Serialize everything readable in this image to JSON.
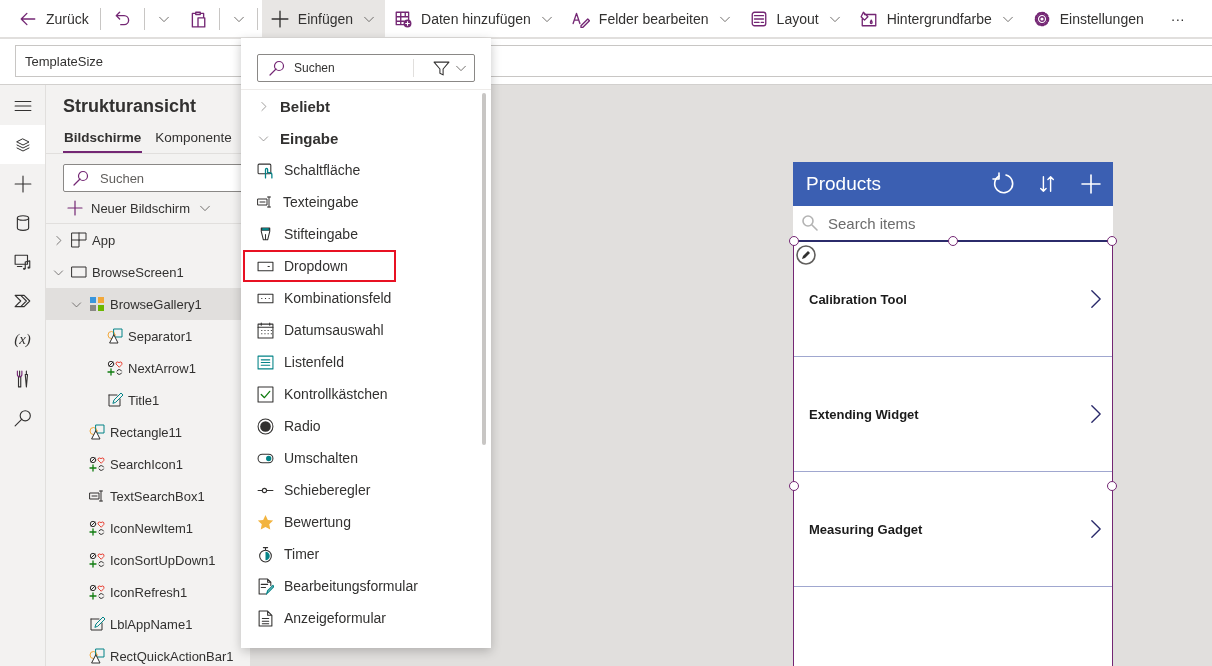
{
  "toolbar": {
    "items": [
      {
        "kind": "back",
        "label": "Zurück",
        "dropdown": false,
        "active": false,
        "divider_after": true
      },
      {
        "kind": "undo",
        "dropdown": true,
        "active": false,
        "divider_after": false
      },
      {
        "kind": "paste",
        "dropdown": true,
        "active": false,
        "divider_after": true
      },
      {
        "kind": "insert",
        "label": "Einfügen",
        "dropdown": true,
        "active": true,
        "divider_after": false
      },
      {
        "kind": "data",
        "label": "Daten hinzufügen",
        "dropdown": true,
        "active": false,
        "divider_after": false
      },
      {
        "kind": "fields",
        "label": "Felder bearbeiten",
        "dropdown": true,
        "active": false,
        "divider_after": false
      },
      {
        "kind": "layout",
        "label": "Layout",
        "dropdown": true,
        "active": false,
        "divider_after": false
      },
      {
        "kind": "bgcolor",
        "label": "Hintergrundfarbe",
        "dropdown": true,
        "active": false,
        "divider_after": false
      },
      {
        "kind": "settings",
        "label": "Einstellungen",
        "dropdown": false,
        "active": false,
        "divider_after": false
      },
      {
        "kind": "more",
        "label": "···",
        "dropdown": false,
        "active": false,
        "divider_after": false
      }
    ]
  },
  "formula_bar": {
    "value": "TemplateSize"
  },
  "rail": {
    "items": [
      {
        "kind": "menu",
        "selected": false
      },
      {
        "kind": "layers",
        "selected": true
      },
      {
        "kind": "insert",
        "selected": false
      },
      {
        "kind": "data",
        "selected": false
      },
      {
        "kind": "media",
        "selected": false
      },
      {
        "kind": "flow",
        "selected": false
      },
      {
        "kind": "variables",
        "label": "(x)",
        "selected": false
      },
      {
        "kind": "tools",
        "selected": false
      },
      {
        "kind": "search",
        "selected": false
      }
    ]
  },
  "tree_panel": {
    "title": "Strukturansicht",
    "tabs": [
      {
        "label": "Bildschirme",
        "selected": true
      },
      {
        "label": "Komponente",
        "selected": false
      }
    ],
    "search": {
      "placeholder": "Suchen"
    },
    "new_screen": "Neuer Bildschirm",
    "nodes": [
      {
        "label": "App",
        "kind": "app",
        "expanded": false,
        "selected": false
      },
      {
        "label": "BrowseScreen1",
        "kind": "screen",
        "expanded": true,
        "selected": false,
        "children": [
          {
            "label": "BrowseGallery1",
            "kind": "gallery",
            "expanded": true,
            "selected": true,
            "children": [
              {
                "label": "Separator1",
                "kind": "shape",
                "selected": false
              },
              {
                "label": "NextArrow1",
                "kind": "icon",
                "selected": false
              },
              {
                "label": "Title1",
                "kind": "label",
                "selected": false
              }
            ]
          },
          {
            "label": "Rectangle11",
            "kind": "shape",
            "selected": false
          },
          {
            "label": "SearchIcon1",
            "kind": "icon",
            "selected": false
          },
          {
            "label": "TextSearchBox1",
            "kind": "textinput",
            "selected": false
          },
          {
            "label": "IconNewItem1",
            "kind": "icon",
            "selected": false
          },
          {
            "label": "IconSortUpDown1",
            "kind": "icon",
            "selected": false
          },
          {
            "label": "IconRefresh1",
            "kind": "icon",
            "selected": false
          },
          {
            "label": "LblAppName1",
            "kind": "label",
            "selected": false
          },
          {
            "label": "RectQuickActionBar1",
            "kind": "shape",
            "selected": false
          }
        ]
      }
    ]
  },
  "insert_menu": {
    "search": {
      "placeholder": "Suchen"
    },
    "categories": [
      {
        "label": "Beliebt",
        "expanded": false
      },
      {
        "label": "Eingabe",
        "expanded": true,
        "items": [
          {
            "label": "Schaltfläche",
            "kind": "button",
            "highlighted": false
          },
          {
            "label": "Texteingabe",
            "kind": "textinput",
            "highlighted": false
          },
          {
            "label": "Stifteingabe",
            "kind": "pen",
            "highlighted": false
          },
          {
            "label": "Dropdown",
            "kind": "dropdown",
            "highlighted": true
          },
          {
            "label": "Kombinationsfeld",
            "kind": "combobox",
            "highlighted": false
          },
          {
            "label": "Datumsauswahl",
            "kind": "date",
            "highlighted": false
          },
          {
            "label": "Listenfeld",
            "kind": "listbox",
            "highlighted": false
          },
          {
            "label": "Kontrollkästchen",
            "kind": "checkbox",
            "highlighted": false
          },
          {
            "label": "Radio",
            "kind": "radio",
            "highlighted": false
          },
          {
            "label": "Umschalten",
            "kind": "toggle",
            "highlighted": false
          },
          {
            "label": "Schieberegler",
            "kind": "slider",
            "highlighted": false
          },
          {
            "label": "Bewertung",
            "kind": "rating",
            "highlighted": false
          },
          {
            "label": "Timer",
            "kind": "timer",
            "highlighted": false
          },
          {
            "label": "Bearbeitungsformular",
            "kind": "editform",
            "highlighted": false
          },
          {
            "label": "Anzeigeformular",
            "kind": "displayform",
            "highlighted": false
          }
        ]
      }
    ]
  },
  "app_preview": {
    "title": "Products",
    "search": {
      "placeholder": "Search items"
    },
    "gallery": {
      "selected": true,
      "rows": [
        {
          "title": "Calibration Tool"
        },
        {
          "title": "Extending Widget"
        },
        {
          "title": "Measuring Gadget"
        }
      ]
    }
  }
}
